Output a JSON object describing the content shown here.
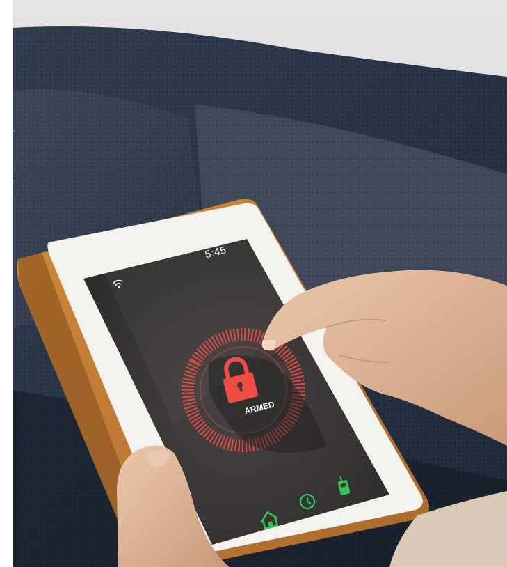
{
  "photo": {
    "subject": "tablet",
    "screen": {
      "clock": "5:45",
      "status_label": "ARMED",
      "icons": [
        "wifi-icon",
        "lock-icon",
        "home-icon",
        "clock-icon",
        "phone-icon"
      ],
      "colors": {
        "armed": "#ef4c45",
        "nav": "#33c55a",
        "screen_bg": "#3a3737"
      }
    }
  }
}
